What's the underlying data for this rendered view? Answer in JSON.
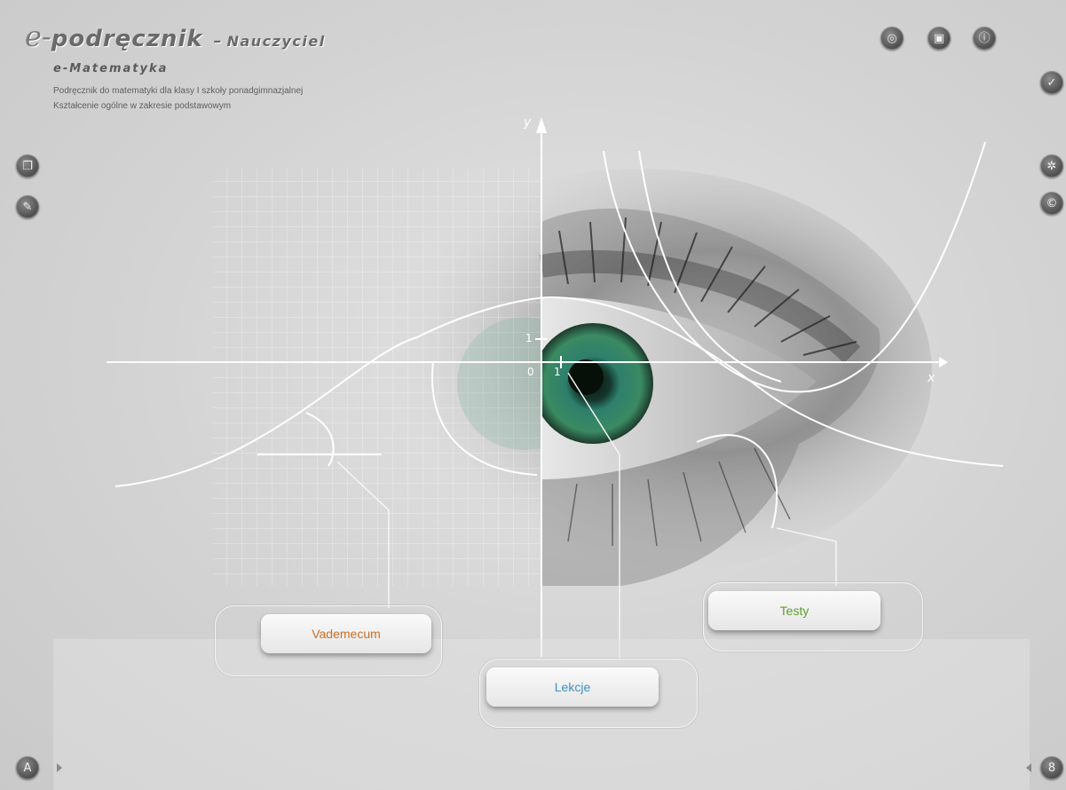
{
  "header": {
    "title_e": "e-",
    "title_brand": "podręcznik",
    "title_sep": "–",
    "title_role": "Nauczyciel",
    "subject": "e-Matematyka",
    "desc_line1": "Podręcznik do matematyki dla klasy I szkoły ponadgimnazjalnej",
    "desc_line2": "Kształcenie ogólne w zakresie podstawowym"
  },
  "toolbar_top": [
    {
      "icon": "lifebuoy-icon",
      "glyph": "◎"
    },
    {
      "icon": "document-icon",
      "glyph": "▣"
    },
    {
      "icon": "info-icon",
      "glyph": "ⓘ"
    }
  ],
  "sidebar_left": [
    {
      "icon": "copy-pages-icon",
      "glyph": "❐"
    },
    {
      "icon": "edit-notes-icon",
      "glyph": "✎"
    }
  ],
  "sidebar_right": [
    {
      "icon": "checkmark-icon",
      "glyph": "✓"
    },
    {
      "icon": "fan-icon",
      "glyph": "✲"
    },
    {
      "icon": "copyright-icon",
      "glyph": "©"
    }
  ],
  "graph_labels": {
    "y_axis": "y",
    "x_axis": "x",
    "origin": "0",
    "one_x": "1",
    "one_y": "1"
  },
  "buttons": {
    "vademecum": "Vademecum",
    "lekcje": "Lekcje",
    "testy": "Testy"
  },
  "colors": {
    "vademecum": "#c8702a",
    "lekcje": "#3c8fc1",
    "testy": "#5aa02c",
    "iris": "#2f7f6a"
  },
  "corner_left": {
    "icon": "compass-tool-icon",
    "glyph": "A"
  },
  "corner_right": {
    "icon": "compass-tool-right-icon",
    "glyph": "8"
  }
}
